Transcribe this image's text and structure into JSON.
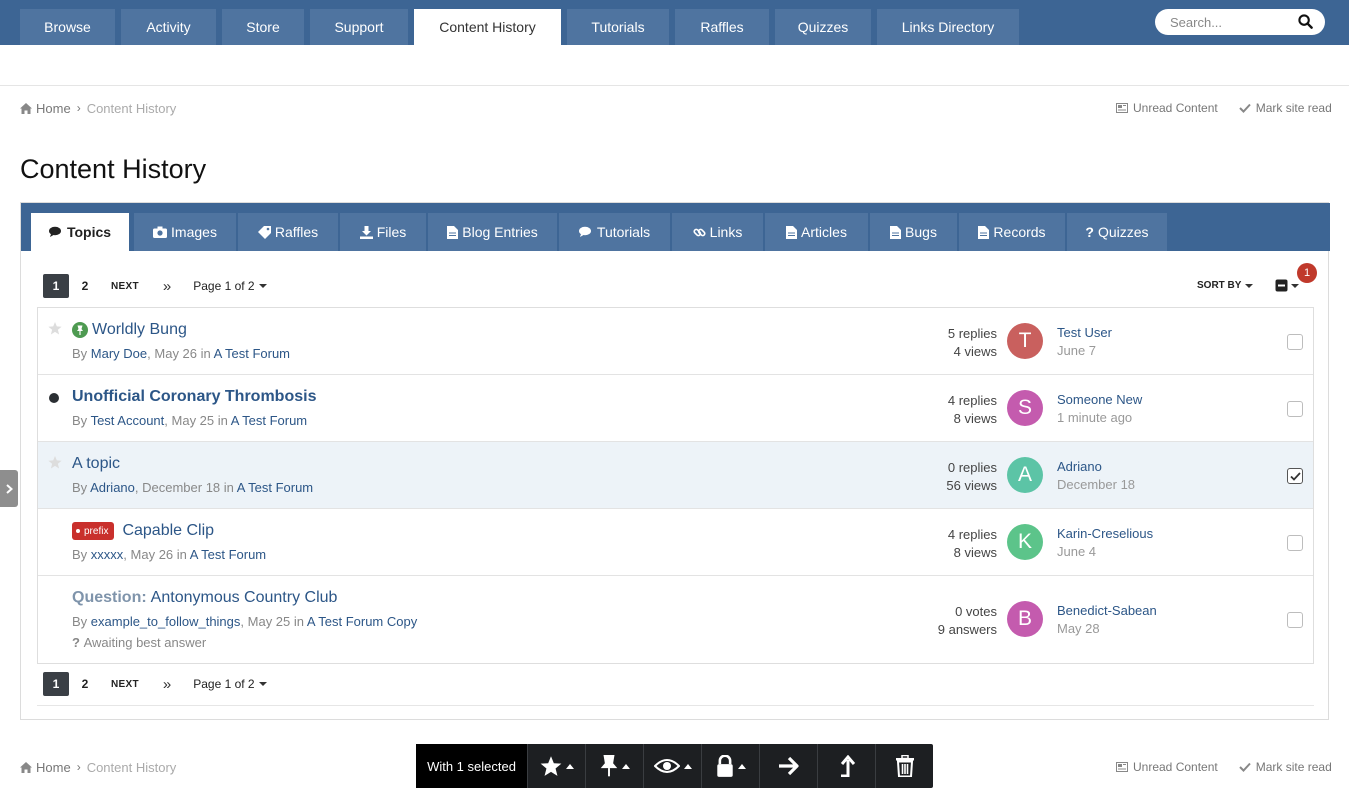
{
  "topnav": {
    "tabs": [
      "Browse",
      "Activity",
      "Store",
      "Support",
      "Content History",
      "Tutorials",
      "Raffles",
      "Quizzes",
      "Links Directory"
    ],
    "search_placeholder": "Search..."
  },
  "breadcrumb": {
    "home": "Home",
    "current": "Content History"
  },
  "crumb_actions": {
    "unread": "Unread Content",
    "mark_read": "Mark site read"
  },
  "page_title": "Content History",
  "content_tabs": [
    "Topics",
    "Images",
    "Raffles",
    "Files",
    "Blog Entries",
    "Tutorials",
    "Links",
    "Articles",
    "Bugs",
    "Records",
    "Quizzes"
  ],
  "pagination": {
    "pages": [
      "1",
      "2"
    ],
    "next": "NEXT",
    "last": "»",
    "page_of": "Page 1 of 2"
  },
  "sort_by": "SORT BY",
  "selected_badge": "1",
  "topics": [
    {
      "title": "Worldly Bung",
      "author": "Mary Doe",
      "date": "May 26",
      "forum": "A Test Forum",
      "stat1": "5 replies",
      "stat2": "4 views",
      "last_initial": "T",
      "last_user": "Test User",
      "last_date": "June 7",
      "avatar_color": "#c9605e"
    },
    {
      "title": "Unofficial Coronary Thrombosis",
      "author": "Test Account",
      "date": "May 25",
      "forum": "A Test Forum",
      "stat1": "4 replies",
      "stat2": "8 views",
      "last_initial": "S",
      "last_user": "Someone New",
      "last_date": "1 minute ago",
      "avatar_color": "#c45bae"
    },
    {
      "title": "A topic",
      "author": "Adriano",
      "date": "December 18",
      "forum": "A Test Forum",
      "stat1": "0 replies",
      "stat2": "56 views",
      "last_initial": "A",
      "last_user": "Adriano",
      "last_date": "December 18",
      "avatar_color": "#5cc4a6"
    },
    {
      "title": "Capable Clip",
      "prefix": "prefix",
      "author": "xxxxx",
      "date": "May 26",
      "forum": "A Test Forum",
      "stat1": "4 replies",
      "stat2": "8 views",
      "last_initial": "K",
      "last_user": "Karin-Creselious",
      "last_date": "June 4",
      "avatar_color": "#5cc48a"
    },
    {
      "title_prefix": "Question:",
      "title": "Antonymous Country Club",
      "author": "example_to_follow_things",
      "date": "May 25",
      "forum": "A Test Forum Copy",
      "extra": "Awaiting best answer",
      "stat1": "0 votes",
      "stat2": "9 answers",
      "last_initial": "B",
      "last_user": "Benedict-Sabean",
      "last_date": "May 28",
      "avatar_color": "#c45bae"
    }
  ],
  "meta_words": {
    "by": "By ",
    "in": " in "
  },
  "modbar": {
    "label": "With 1 selected"
  }
}
